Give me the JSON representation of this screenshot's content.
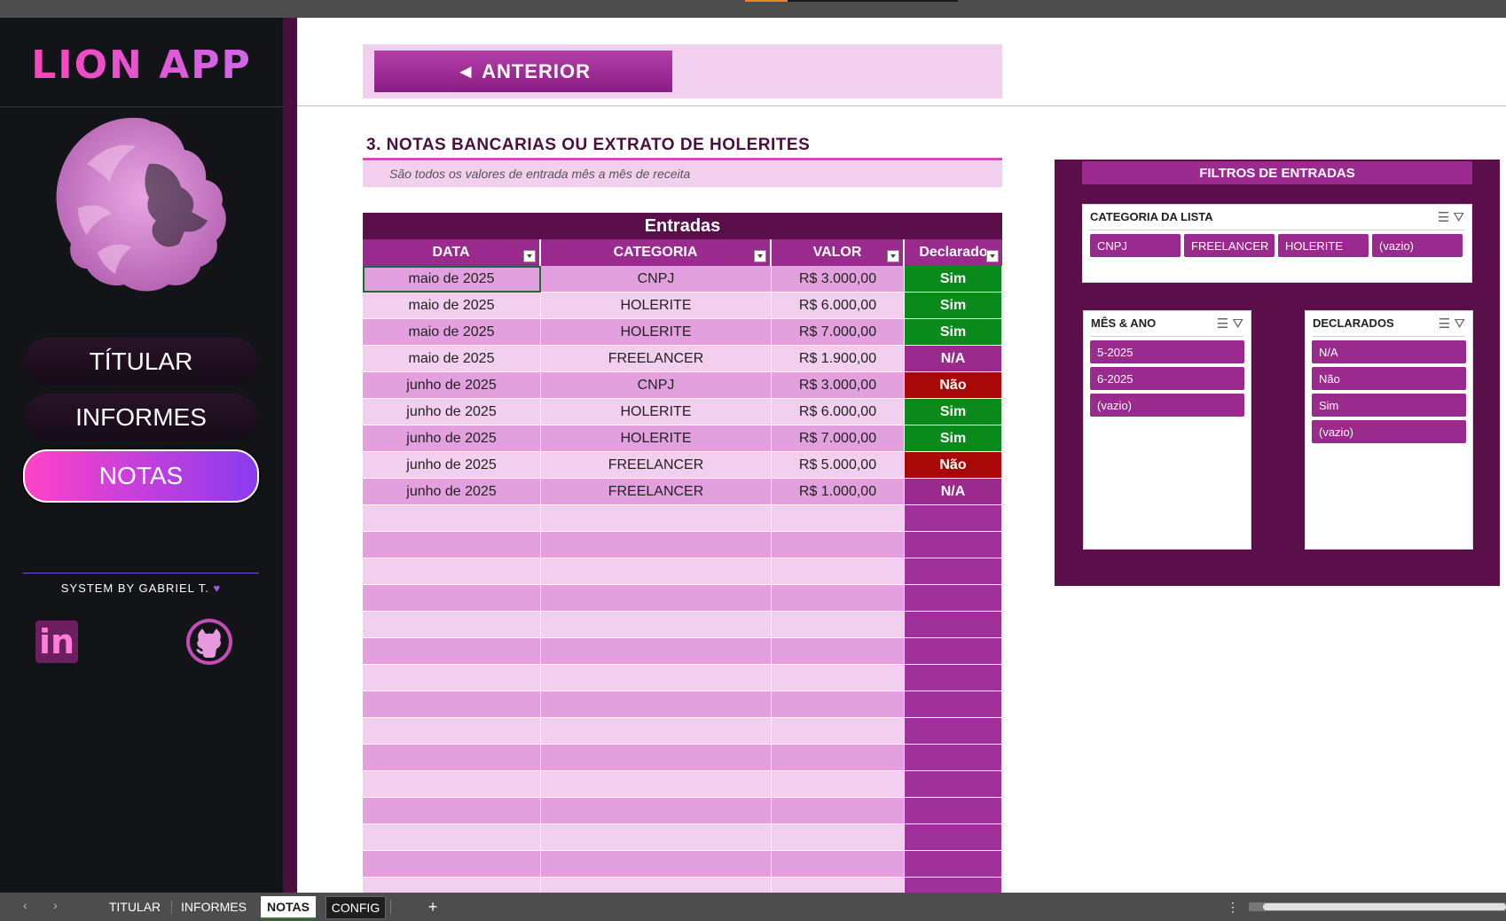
{
  "app": {
    "brand": "LION APP",
    "system_credit": "SYSTEM BY GABRIEL T."
  },
  "nav": [
    {
      "label": "TÍTULAR",
      "active": false
    },
    {
      "label": "INFORMES",
      "active": false
    },
    {
      "label": "NOTAS",
      "active": true
    }
  ],
  "social": {
    "linkedin": "in",
    "github_icon": "github-icon"
  },
  "toolbar": {
    "previous_label": "◄ ANTERIOR"
  },
  "section": {
    "title": "3. NOTAS BANCARIAS OU EXTRATO DE HOLERITES",
    "subtitle": "São todos os valores de entrada mês a mês de receita"
  },
  "table": {
    "title": "Entradas",
    "columns": [
      "DATA",
      "CATEGORIA",
      "VALOR",
      "Declarado"
    ],
    "rows": [
      [
        "maio de 2025",
        "CNPJ",
        "R$ 3.000,00",
        "Sim"
      ],
      [
        "maio de 2025",
        "HOLERITE",
        "R$ 6.000,00",
        "Sim"
      ],
      [
        "maio de 2025",
        "HOLERITE",
        "R$ 7.000,00",
        "Sim"
      ],
      [
        "maio de 2025",
        "FREELANCER",
        "R$ 1.900,00",
        "N/A"
      ],
      [
        "junho de 2025",
        "CNPJ",
        "R$ 3.000,00",
        "Não"
      ],
      [
        "junho de 2025",
        "HOLERITE",
        "R$ 6.000,00",
        "Sim"
      ],
      [
        "junho de 2025",
        "HOLERITE",
        "R$ 7.000,00",
        "Sim"
      ],
      [
        "junho de 2025",
        "FREELANCER",
        "R$ 5.000,00",
        "Não"
      ],
      [
        "junho de 2025",
        "FREELANCER",
        "R$ 1.000,00",
        "N/A"
      ]
    ],
    "empty_rows": 15
  },
  "colors": {
    "sim": "#0a8a1a",
    "nao": "#a80808",
    "na": "#9b2a8e",
    "row_a": "#e3a0de",
    "row_b": "#f2cfee",
    "empty_decl": "#a0309a"
  },
  "filters": {
    "title": "FILTROS DE ENTRADAS",
    "categoria": {
      "title": "CATEGORIA DA LISTA",
      "items": [
        "CNPJ",
        "FREELANCER",
        "HOLERITE",
        "(vazio)"
      ]
    },
    "mes_ano": {
      "title": "MÊS & ANO",
      "items": [
        "5-2025",
        "6-2025",
        "(vazio)"
      ]
    },
    "declarados": {
      "title": "DECLARADOS",
      "items": [
        "N/A",
        "Não",
        "Sim",
        "(vazio)"
      ]
    }
  },
  "sheet_tabs": [
    {
      "label": "TITULAR",
      "active": false
    },
    {
      "label": "INFORMES",
      "active": false
    },
    {
      "label": "NOTAS",
      "active": true
    },
    {
      "label": "CONFIG",
      "active": false
    }
  ],
  "statusbar": {
    "add_sheet": "+",
    "more": "⋮",
    "prev_arrow": "‹",
    "next_arrow": "›"
  }
}
